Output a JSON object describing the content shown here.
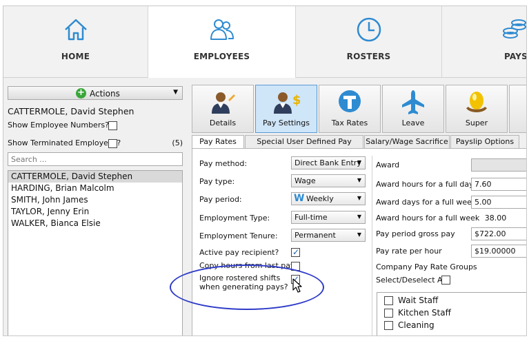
{
  "nav": {
    "tabs": [
      {
        "label": "HOME",
        "icon": "home-icon"
      },
      {
        "label": "EMPLOYEES",
        "icon": "people-icon"
      },
      {
        "label": "ROSTERS",
        "icon": "clock-icon"
      },
      {
        "label": "PAYS",
        "icon": "coins-icon"
      }
    ],
    "active": "EMPLOYEES"
  },
  "left": {
    "actions_label": "Actions",
    "selected_employee": "CATTERMOLE, David Stephen",
    "show_numbers_label": "Show Employee Numbers?",
    "show_terminated_label": "Show Terminated Employees?",
    "terminated_count": "(5)",
    "search_placeholder": "Search ...",
    "employees": [
      "CATTERMOLE, David Stephen",
      "HARDING, Brian Malcolm",
      "SMITH, John James",
      "TAYLOR, Jenny Erin",
      "WALKER, Bianca Elsie"
    ]
  },
  "toolbar": {
    "buttons": [
      {
        "label": "Details",
        "icon": "person-pencil-icon"
      },
      {
        "label": "Pay Settings",
        "icon": "person-dollar-icon"
      },
      {
        "label": "Tax Rates",
        "icon": "tax-t-icon"
      },
      {
        "label": "Leave",
        "icon": "airplane-icon"
      },
      {
        "label": "Super",
        "icon": "nest-egg-icon"
      }
    ],
    "active": "Pay Settings"
  },
  "subtabs": [
    "Pay Rates",
    "Special User Defined Pay Rates",
    "Salary/Wage Sacrifice",
    "Payslip Options"
  ],
  "form": {
    "pay_method_label": "Pay method:",
    "pay_method_value": "Direct Bank Entry",
    "pay_type_label": "Pay type:",
    "pay_type_value": "Wage",
    "pay_period_label": "Pay period:",
    "pay_period_value": "Weekly",
    "employment_type_label": "Employment Type:",
    "employment_type_value": "Full-time",
    "employment_tenure_label": "Employment Tenure:",
    "employment_tenure_value": "Permanent",
    "active_recipient_label": "Active pay recipient?",
    "copy_hours_label": "Copy hours from last pay?",
    "ignore_label_1": "Ignore rostered shifts",
    "ignore_label_2": "when generating pays?"
  },
  "award": {
    "award_label": "Award",
    "award_hours_day_label": "Award hours for a full day",
    "award_hours_day_value": "7.60",
    "award_days_week_label": "Award days for a full week",
    "award_days_week_value": "5.00",
    "award_hours_week_label": "Award hours for a full week",
    "award_hours_week_value": "38.00",
    "gross_pay_label": "Pay period gross pay",
    "gross_pay_value": "$722.00",
    "rate_per_hour_label": "Pay rate per hour",
    "rate_per_hour_value": "$19.00000",
    "groups_label": "Company Pay Rate Groups",
    "select_all_label": "Select/Deselect All",
    "groups": [
      "Wait Staff",
      "Kitchen Staff",
      "Cleaning"
    ]
  },
  "colors": {
    "highlight_ellipse": "#2e3bc8",
    "active_tab": "#cfe5f8",
    "accent_blue": "#2e8bd1"
  }
}
